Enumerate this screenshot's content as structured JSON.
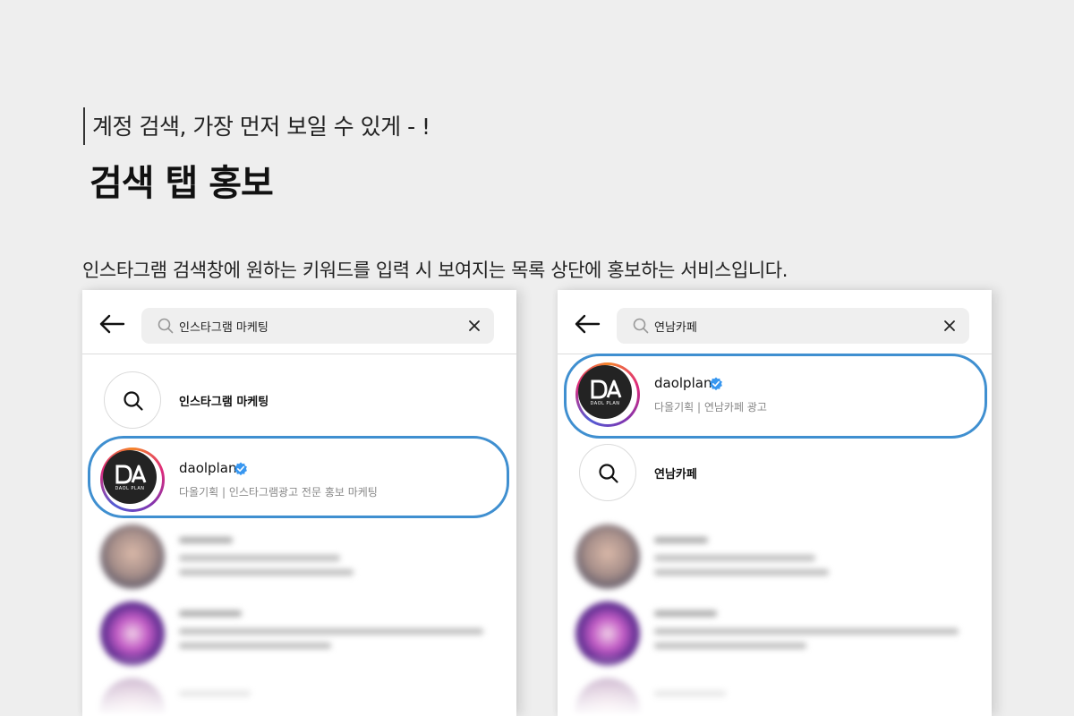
{
  "header": {
    "subtitle": "계정 검색, 가장 먼저 보일 수 있게 - !",
    "title": "검색 탭 홍보"
  },
  "description": "인스타그램 검색창에 원하는 키워드를 입력 시 보여지는 목록 상단에 홍보하는 서비스입니다.",
  "colors": {
    "highlight": "#3f8fd0",
    "verified": "#3897f0",
    "background": "#eeeeee"
  },
  "left_panel": {
    "search_query": "인스타그램 마케팅",
    "keyword_suggestion": "인스타그램 마케팅",
    "account": {
      "username": "daolplan",
      "verified": true,
      "description": "다올기획  |  인스타그램광고 전문 홍보 마케팅",
      "logo_text": "DAOL PLAN"
    }
  },
  "right_panel": {
    "search_query": "연남카페",
    "keyword_suggestion": "연남카페",
    "account": {
      "username": "daolplan",
      "verified": true,
      "description": "다올기획  |  연남카페 광고",
      "logo_text": "DAOL PLAN"
    }
  },
  "icons": [
    "back-arrow-icon",
    "search-icon",
    "clear-icon",
    "verified-badge-icon"
  ]
}
